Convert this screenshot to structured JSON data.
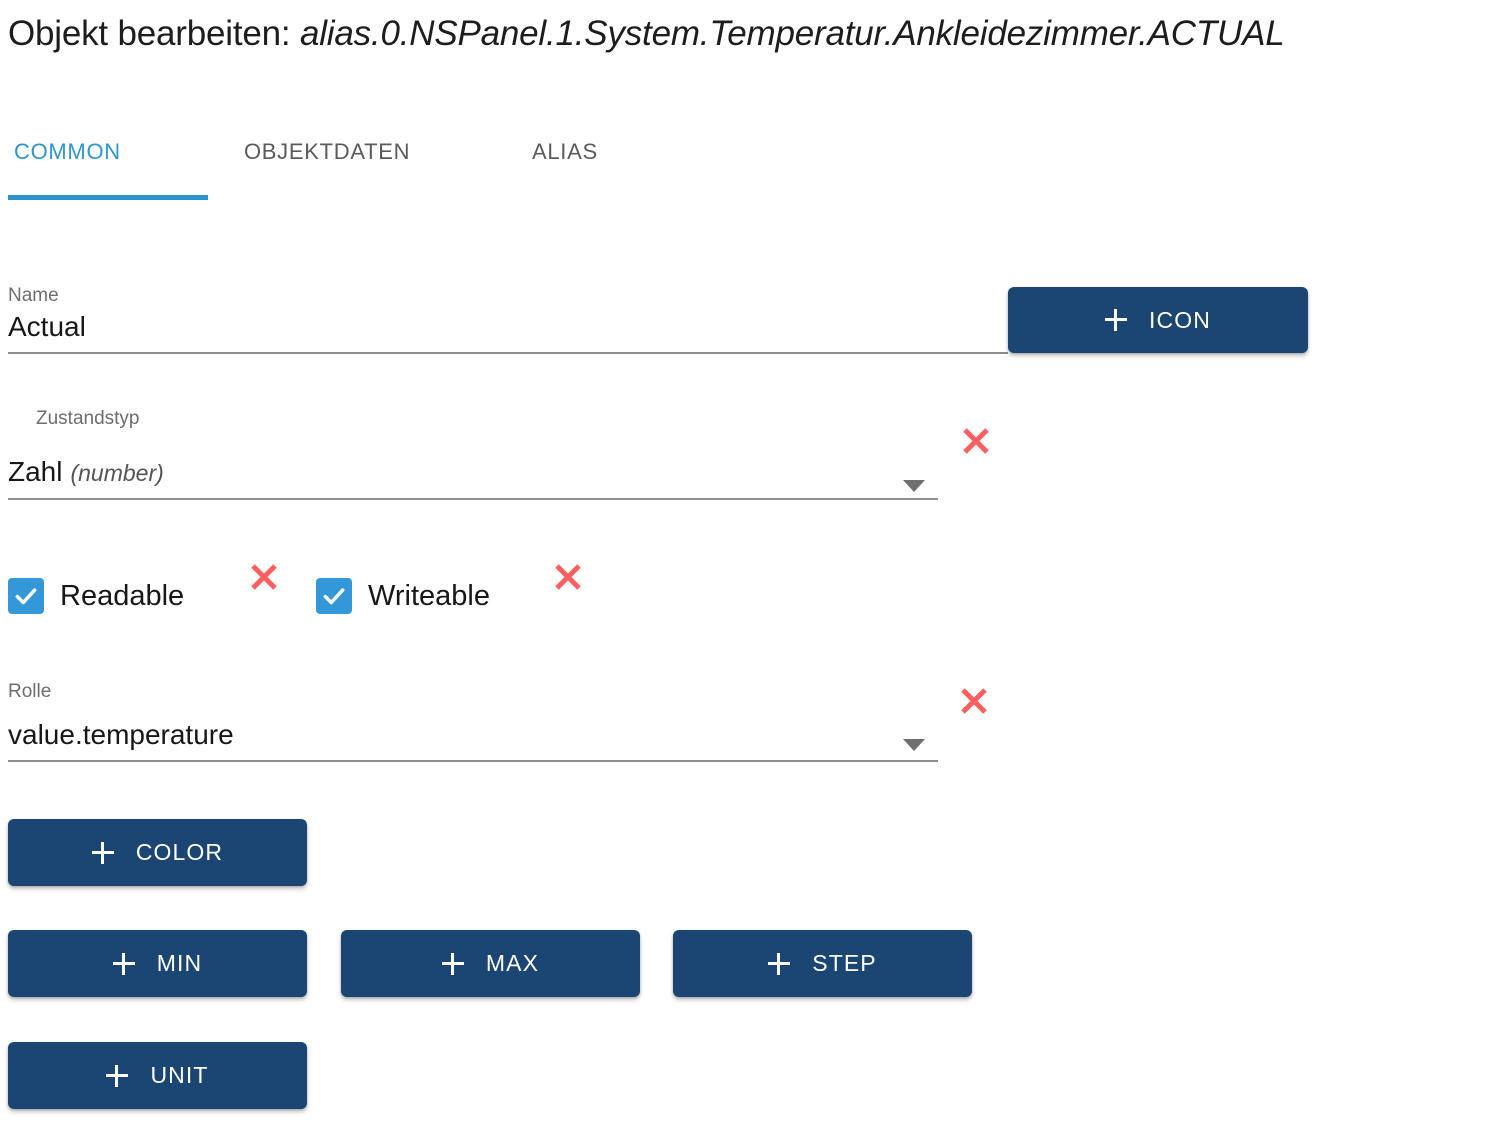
{
  "header": {
    "title_prefix": "Objekt bearbeiten: ",
    "object_path": "alias.0.NSPanel.1.System.Temperatur.Ankleidezimmer.ACTUAL"
  },
  "tabs": [
    {
      "label": "COMMON",
      "active": true
    },
    {
      "label": "OBJEKTDATEN",
      "active": false
    },
    {
      "label": "ALIAS",
      "active": false
    }
  ],
  "fields": {
    "name": {
      "label": "Name",
      "value": "Actual"
    },
    "state_type": {
      "label": "Zustandstyp",
      "value": "Zahl",
      "value_note": "(number)",
      "clear_icon": "close-x-icon"
    },
    "role": {
      "label": "Rolle",
      "value": "value.temperature",
      "clear_icon": "close-x-icon"
    }
  },
  "checkboxes": [
    {
      "label": "Readable",
      "checked": true,
      "clear_icon": "close-x-icon"
    },
    {
      "label": "Writeable",
      "checked": true,
      "clear_icon": "close-x-icon"
    }
  ],
  "buttons": {
    "icon": "ICON",
    "color": "COLOR",
    "min": "MIN",
    "max": "MAX",
    "step": "STEP",
    "unit": "UNIT"
  },
  "colors": {
    "button_bg": "#1b4572",
    "accent_blue": "#2a93cb",
    "checkbox_blue": "#3498d8",
    "clear_red": "#fa6060",
    "label_gray": "#6d6d6d",
    "underline_gray": "#8d8d8d"
  },
  "icons": {
    "plus": "plus-icon",
    "caret": "chevron-down-icon",
    "check": "check-icon"
  }
}
